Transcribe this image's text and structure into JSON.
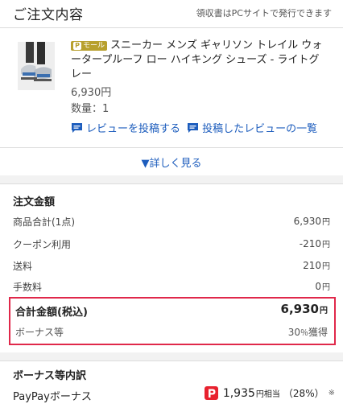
{
  "header": {
    "title": "ご注文内容",
    "receipt_note": "領収書はPCサイトで発行できます"
  },
  "product": {
    "mall_badge": "モール",
    "name": "スニーカー メンズ ギャリソン トレイル ウォータープルーフ ロー ハイキング シューズ - ライトグレー",
    "price": "6,930円",
    "quantity": "数量：1",
    "review_links": {
      "post_review": "レビューを投稿する",
      "posted_reviews": "投稿したレビューの一覧"
    },
    "details_toggle": "▼詳しく見る"
  },
  "order_amount": {
    "heading": "注文金額",
    "rows": [
      {
        "label": "商品合計(1点)",
        "value": "6,930",
        "unit": "円"
      },
      {
        "label": "クーポン利用",
        "value": "-210",
        "unit": "円"
      },
      {
        "label": "送料",
        "value": "210",
        "unit": "円"
      },
      {
        "label": "手数料",
        "value": "0",
        "unit": "円"
      }
    ],
    "total": {
      "label": "合計金額(税込)",
      "value": "6,930",
      "unit": "円"
    },
    "bonus": {
      "label": "ボーナス等",
      "value": "30",
      "pct": "％",
      "suffix": "獲得"
    }
  },
  "bonus_breakdown": {
    "heading": "ボーナス等内訳",
    "paypay": {
      "label": "PayPayボーナス",
      "amount": "1,935",
      "unit": "円相当",
      "pct": "（28%）",
      "note": "※"
    }
  },
  "colors": {
    "link_blue": "#1d5dbd",
    "highlight_red": "#e0284a",
    "mall_gold": "#b8a02e",
    "paypay_red": "#e8212e"
  },
  "icons": {
    "comment": "comment-bubble-icon",
    "paypay": "paypay-logo-icon"
  }
}
